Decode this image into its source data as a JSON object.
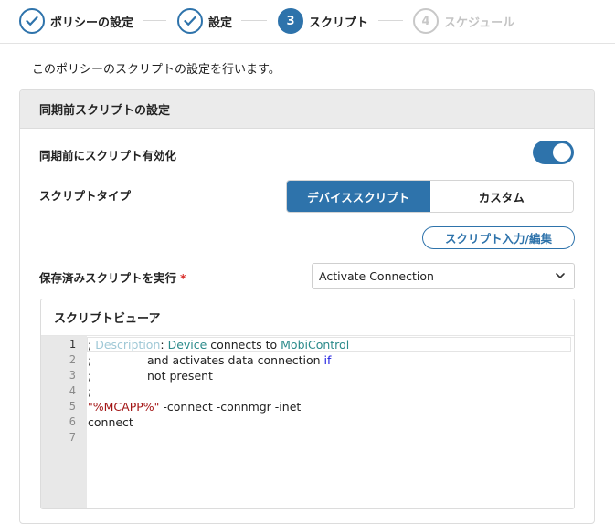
{
  "wizard": {
    "steps": [
      {
        "number": "1",
        "label": "ポリシーの設定",
        "state": "done"
      },
      {
        "number": "2",
        "label": "設定",
        "state": "done"
      },
      {
        "number": "3",
        "label": "スクリプト",
        "state": "active"
      },
      {
        "number": "4",
        "label": "スケジュール",
        "state": "pending"
      }
    ]
  },
  "intro_text": "このポリシーのスクリプトの設定を行います。",
  "panel": {
    "title": "同期前スクリプトの設定",
    "enable_label": "同期前にスクリプト有効化",
    "enable_on": true,
    "script_type_label": "スクリプトタイプ",
    "script_types": [
      "デバイススクリプト",
      "カスタム"
    ],
    "script_type_selected": "デバイススクリプト",
    "edit_button": "スクリプト入力/編集",
    "saved_script_label": "保存済みスクリプトを実行",
    "required_mark": "*",
    "saved_script_value": "Activate Connection",
    "viewer_title": "スクリプトビューア",
    "line_numbers": [
      "1",
      "2",
      "3",
      "4",
      "5",
      "6",
      "7"
    ],
    "code": {
      "l1_semicolon": "; ",
      "l1_desc": "Description",
      "l1_colon": ": ",
      "l1_device": "Device",
      "l1_mid": " connects to ",
      "l1_mobi": "MobiControl",
      "l2_semicolon": ";",
      "l2_text": "and activates data connection ",
      "l2_if": "if",
      "l3_semicolon": ";",
      "l3_text": "not present",
      "l4": ";",
      "l5_str": "\"%MCAPP%\"",
      "l5_rest": " -connect -connmgr -inet",
      "l6": "connect"
    }
  },
  "colors": {
    "accent": "#2e73ab",
    "required": "#d9302c",
    "pending": "#c8c8c8"
  },
  "icons": [
    "check-icon",
    "chevron-down-icon"
  ]
}
